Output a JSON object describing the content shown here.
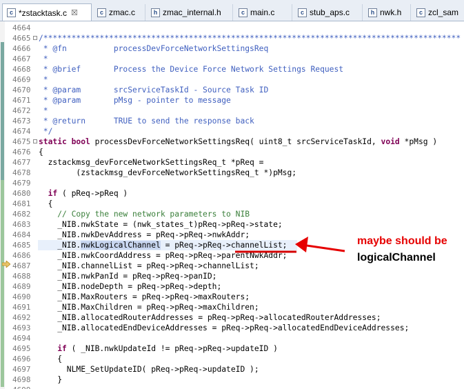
{
  "tabs": [
    {
      "label": "*zstacktask.c",
      "icon": "c-file-icon",
      "glyph": "c",
      "active": true,
      "close": "☒"
    },
    {
      "label": "zmac.c",
      "icon": "c-file-icon",
      "glyph": "c",
      "active": false
    },
    {
      "label": "zmac_internal.h",
      "icon": "h-file-icon",
      "glyph": "h",
      "active": false
    },
    {
      "label": "main.c",
      "icon": "c-file-icon",
      "glyph": "c",
      "active": false
    },
    {
      "label": "stub_aps.c",
      "icon": "c-file-icon",
      "glyph": "c",
      "active": false
    },
    {
      "label": "nwk.h",
      "icon": "h-file-icon",
      "glyph": "h",
      "active": false
    },
    {
      "label": "zcl_sam",
      "icon": "c-file-icon",
      "glyph": "c",
      "active": false
    }
  ],
  "lines": [
    {
      "n": "4664",
      "parts": [
        {
          "t": "",
          "c": ""
        }
      ]
    },
    {
      "n": "4665",
      "parts": [
        {
          "t": "/*****************************************************************************************",
          "c": "c-doc"
        }
      ],
      "fold": true
    },
    {
      "n": "4666",
      "parts": [
        {
          "t": " * @fn          processDevForceNetworkSettingsReq",
          "c": "c-doc"
        }
      ]
    },
    {
      "n": "4667",
      "parts": [
        {
          "t": " *",
          "c": "c-doc"
        }
      ]
    },
    {
      "n": "4668",
      "parts": [
        {
          "t": " * @brief       Process the Device Force Network Settings Request",
          "c": "c-doc"
        }
      ]
    },
    {
      "n": "4669",
      "parts": [
        {
          "t": " *",
          "c": "c-doc"
        }
      ]
    },
    {
      "n": "4670",
      "parts": [
        {
          "t": " * @param       srcServiceTaskId - Source Task ID",
          "c": "c-doc"
        }
      ]
    },
    {
      "n": "4671",
      "parts": [
        {
          "t": " * @param       pMsg - pointer to message",
          "c": "c-doc"
        }
      ]
    },
    {
      "n": "4672",
      "parts": [
        {
          "t": " *",
          "c": "c-doc"
        }
      ]
    },
    {
      "n": "4673",
      "parts": [
        {
          "t": " * @return      TRUE to send the response back",
          "c": "c-doc"
        }
      ]
    },
    {
      "n": "4674",
      "parts": [
        {
          "t": " */",
          "c": "c-doc"
        }
      ]
    },
    {
      "n": "4675",
      "parts": [
        {
          "t": "static bool",
          "c": "c-kw"
        },
        {
          "t": " processDevForceNetworkSettingsReq( uint8_t srcServiceTaskId, ",
          "c": ""
        },
        {
          "t": "void",
          "c": "c-kw"
        },
        {
          "t": " *pMsg )",
          "c": ""
        }
      ],
      "fold": true
    },
    {
      "n": "4676",
      "parts": [
        {
          "t": "{",
          "c": ""
        }
      ]
    },
    {
      "n": "4677",
      "parts": [
        {
          "t": "  zstackmsg_devForceNetworkSettingsReq_t *pReq =",
          "c": ""
        }
      ]
    },
    {
      "n": "4678",
      "parts": [
        {
          "t": "        (zstackmsg_devForceNetworkSettingsReq_t *)pMsg;",
          "c": ""
        }
      ]
    },
    {
      "n": "4679",
      "parts": [
        {
          "t": "",
          "c": ""
        }
      ]
    },
    {
      "n": "4680",
      "parts": [
        {
          "t": "  ",
          "c": ""
        },
        {
          "t": "if",
          "c": "c-kw"
        },
        {
          "t": " ( pReq->pReq )",
          "c": ""
        }
      ]
    },
    {
      "n": "4681",
      "parts": [
        {
          "t": "  {",
          "c": ""
        }
      ]
    },
    {
      "n": "4682",
      "parts": [
        {
          "t": "    // Copy the new network parameters to NIB",
          "c": "c-comment"
        }
      ]
    },
    {
      "n": "4683",
      "parts": [
        {
          "t": "    _NIB.nwkState = (nwk_states_t)pReq->pReq->state;",
          "c": ""
        }
      ]
    },
    {
      "n": "4684",
      "parts": [
        {
          "t": "    _NIB.nwkDevAddress = pReq->pReq->nwkAddr;",
          "c": ""
        }
      ]
    },
    {
      "n": "4685",
      "parts": [
        {
          "t": "    _NIB.",
          "c": ""
        },
        {
          "t": "nwkLogicalChannel",
          "c": "nwkhl"
        },
        {
          "t": " = pReq->pReq->channelList;",
          "c": ""
        }
      ],
      "current": true
    },
    {
      "n": "4686",
      "parts": [
        {
          "t": "    _NIB.nwkCoordAddress = pReq->pReq->parentNwkAddr;",
          "c": ""
        }
      ]
    },
    {
      "n": "4687",
      "parts": [
        {
          "t": "    _NIB.channelList = pReq->pReq->channelList;",
          "c": ""
        }
      ]
    },
    {
      "n": "4688",
      "parts": [
        {
          "t": "    _NIB.nwkPanId = pReq->pReq->panID;",
          "c": ""
        }
      ]
    },
    {
      "n": "4689",
      "parts": [
        {
          "t": "    _NIB.nodeDepth = pReq->pReq->depth;",
          "c": ""
        }
      ]
    },
    {
      "n": "4690",
      "parts": [
        {
          "t": "    _NIB.MaxRouters = pReq->pReq->maxRouters;",
          "c": ""
        }
      ]
    },
    {
      "n": "4691",
      "parts": [
        {
          "t": "    _NIB.MaxChildren = pReq->pReq->maxChildren;",
          "c": ""
        }
      ]
    },
    {
      "n": "4692",
      "parts": [
        {
          "t": "    _NIB.allocatedRouterAddresses = pReq->pReq->allocatedRouterAddresses;",
          "c": ""
        }
      ]
    },
    {
      "n": "4693",
      "parts": [
        {
          "t": "    _NIB.allocatedEndDeviceAddresses = pReq->pReq->allocatedEndDeviceAddresses;",
          "c": ""
        }
      ]
    },
    {
      "n": "4694",
      "parts": [
        {
          "t": "",
          "c": ""
        }
      ]
    },
    {
      "n": "4695",
      "parts": [
        {
          "t": "    ",
          "c": ""
        },
        {
          "t": "if",
          "c": "c-kw"
        },
        {
          "t": " ( _NIB.nwkUpdateId != pReq->pReq->updateID )",
          "c": ""
        }
      ]
    },
    {
      "n": "4696",
      "parts": [
        {
          "t": "    {",
          "c": ""
        }
      ]
    },
    {
      "n": "4697",
      "parts": [
        {
          "t": "      NLME_SetUpdateID( pReq->pReq->updateID );",
          "c": ""
        }
      ]
    },
    {
      "n": "4698",
      "parts": [
        {
          "t": "    }",
          "c": ""
        }
      ]
    },
    {
      "n": "4699",
      "parts": [
        {
          "t": "",
          "c": ""
        }
      ]
    }
  ],
  "annotation": {
    "line1": "maybe should be",
    "line2": "logicalChannel",
    "color_red": "#e60000"
  }
}
